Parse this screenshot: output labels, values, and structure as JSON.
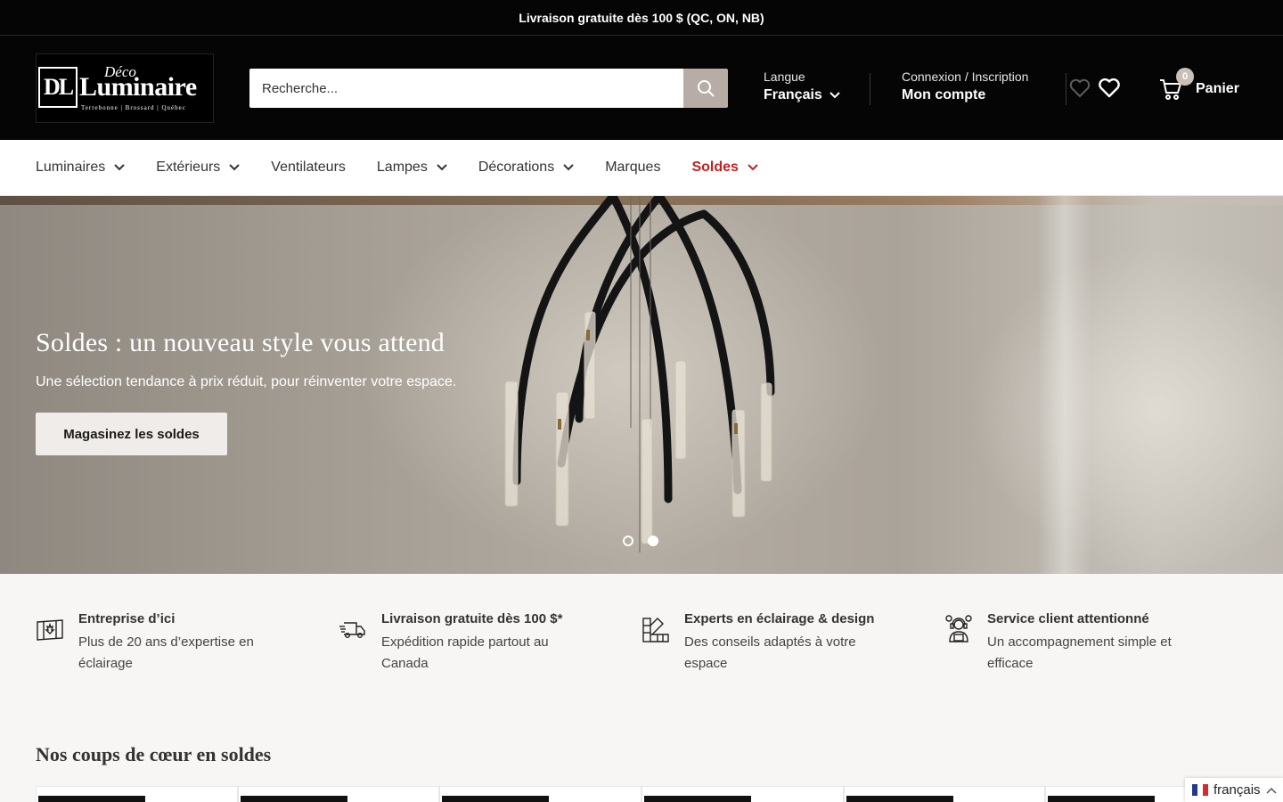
{
  "announcement": "Livraison gratuite dès 100 $ (QC, ON, NB)",
  "logo": {
    "mark": "DL",
    "top": "Déco",
    "main": "Luminaire",
    "sub": "Terrebonne | Brossard | Québec"
  },
  "search": {
    "placeholder": "Recherche..."
  },
  "language": {
    "label": "Langue",
    "value": "Français"
  },
  "account": {
    "label": "Connexion / Inscription",
    "value": "Mon compte"
  },
  "cart": {
    "count": "0",
    "label": "Panier"
  },
  "nav": {
    "items": [
      {
        "label": "Luminaires",
        "dropdown": true
      },
      {
        "label": "Extérieurs",
        "dropdown": true
      },
      {
        "label": "Ventilateurs",
        "dropdown": false
      },
      {
        "label": "Lampes",
        "dropdown": true
      },
      {
        "label": "Décorations",
        "dropdown": true
      },
      {
        "label": "Marques",
        "dropdown": false
      },
      {
        "label": "Soldes",
        "dropdown": true,
        "highlight": "#c02222"
      }
    ]
  },
  "hero": {
    "title": "Soldes : un nouveau style vous attend",
    "subtitle": "Une sélection tendance à prix réduit, pour réinventer votre espace.",
    "button": "Magasinez les soldes",
    "slides": 2,
    "active_slide": 2
  },
  "features": [
    {
      "icon": "canada-flag-icon",
      "title": "Entreprise d’ici",
      "text": "Plus de 20 ans d’expertise en éclairage"
    },
    {
      "icon": "delivery-truck-icon",
      "title": "Livraison gratuite dès 100 $*",
      "text": "Expédition rapide partout au Canada"
    },
    {
      "icon": "color-swatch-icon",
      "title": "Experts en éclairage & design",
      "text": "Des conseils adaptés à votre espace"
    },
    {
      "icon": "support-agent-icon",
      "title": "Service client attentionné",
      "text": "Un accompagnement simple et efficace"
    }
  ],
  "section": {
    "title": "Nos coups de cœur en soldes"
  },
  "lang_widget": {
    "label": "français"
  },
  "colors": {
    "header_bg": "#050505",
    "sale": "#c02222",
    "search_button": "#b8ada6",
    "page_bg": "#f7f6f4"
  }
}
